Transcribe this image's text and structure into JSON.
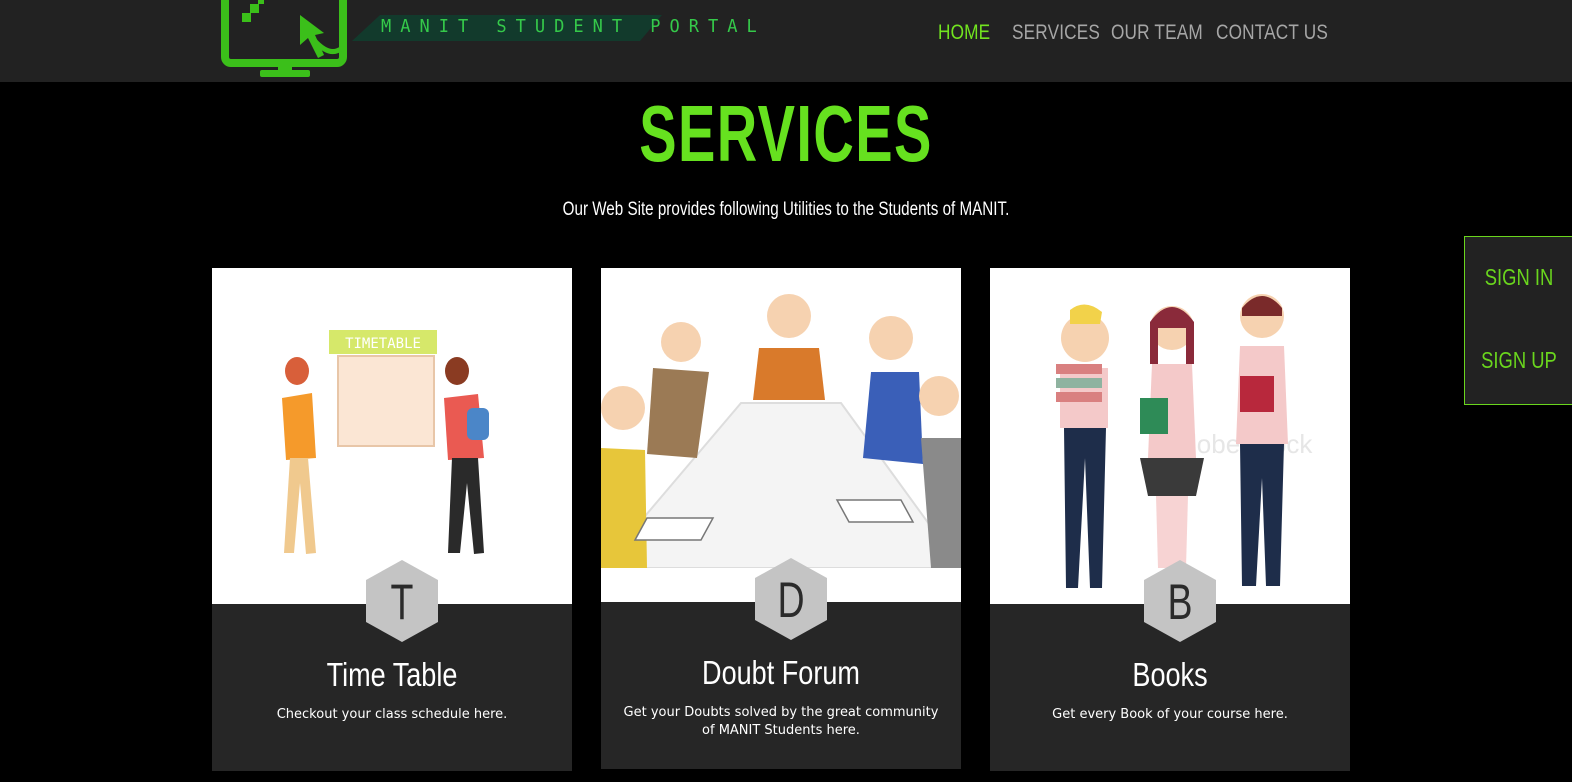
{
  "brand": {
    "logo_text": "MANIT STUDENT PORTAL"
  },
  "nav": {
    "items": [
      "HOME",
      "SERVICES",
      "OUR TEAM",
      "CONTACT US"
    ],
    "active": "HOME"
  },
  "hero": {
    "title": "SERVICES",
    "subtitle": "Our Web Site provides following Utilities to the Students of MANIT."
  },
  "auth": {
    "sign_in": "SIGN IN",
    "sign_up": "SIGN UP"
  },
  "cards": [
    {
      "letter": "T",
      "title": "Time Table",
      "description": "Checkout your class schedule here.",
      "image_label": "TIMETABLE"
    },
    {
      "letter": "D",
      "title": "Doubt Forum",
      "description": "Get your Doubts solved by the great community of MANIT Students here."
    },
    {
      "letter": "B",
      "title": "Books",
      "description": "Get every Book of your course here.",
      "image_watermark": "Adobe Stock"
    }
  ],
  "colors": {
    "accent": "#66e11f",
    "nav_bg": "#222222",
    "card_bg": "#262626",
    "page_bg": "#000000"
  }
}
